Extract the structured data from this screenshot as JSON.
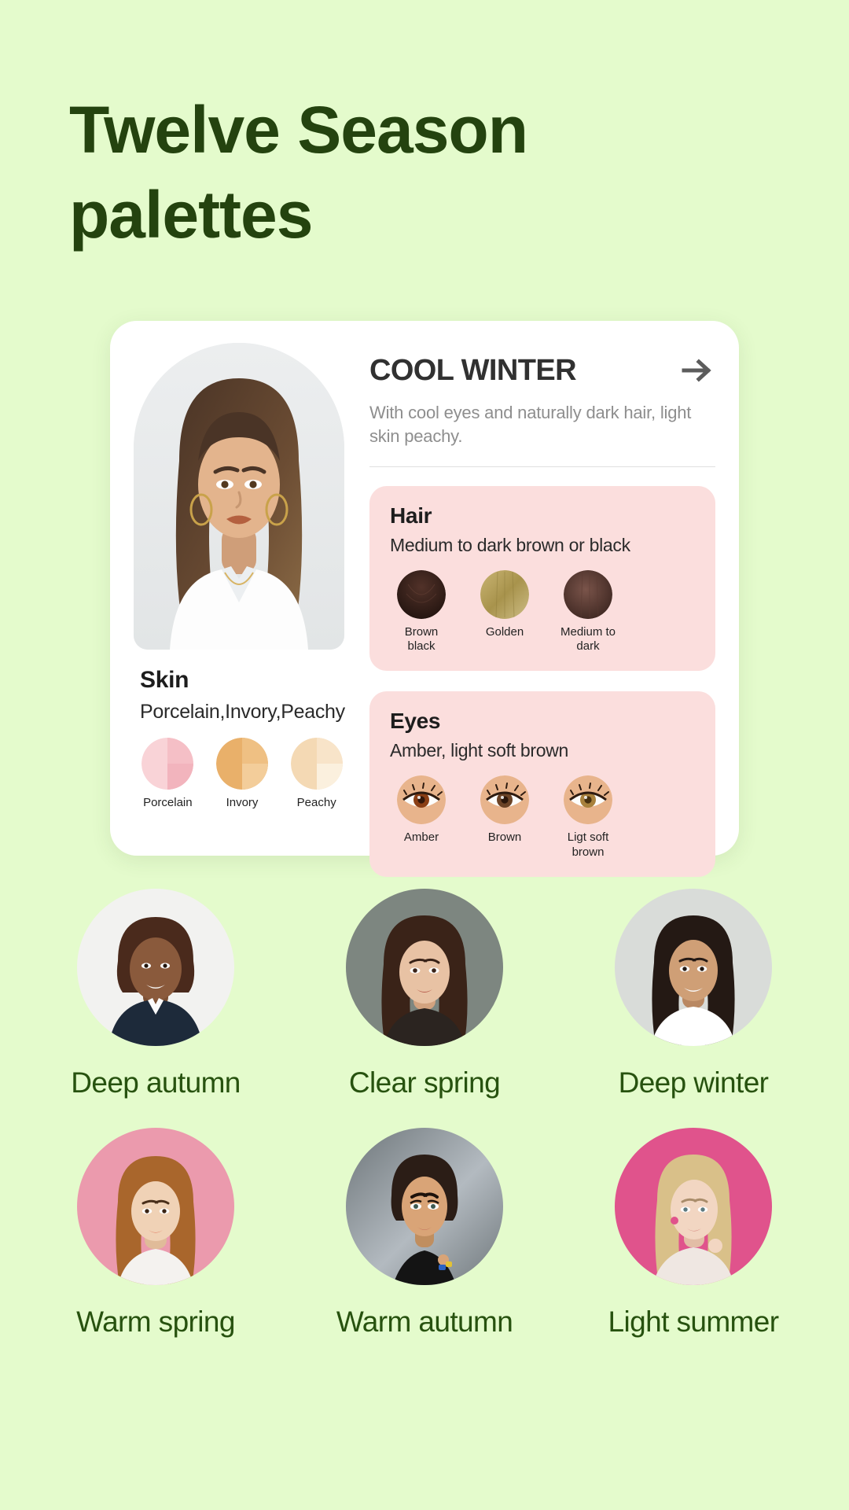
{
  "theme": {
    "background": "#e4fbcc",
    "title_color": "#24430f",
    "card_background": "#ffffff",
    "feature_box_background": "#fbdedd",
    "label_color": "#27520f"
  },
  "page": {
    "title": "Twelve Season palettes"
  },
  "card": {
    "season_name": "COOL WINTER",
    "arrow_icon": "arrow-right-icon",
    "description": "With cool eyes and naturally dark hair, light skin peachy.",
    "portrait_alt": "Cool winter model portrait",
    "skin": {
      "title": "Skin",
      "description": "Porcelain,Invory,Peachy",
      "swatches": [
        {
          "label": "Porcelain",
          "color": "#f7c9ce",
          "color2": "#fbdade"
        },
        {
          "label": "Invory",
          "color": "#e9b06a",
          "color2": "#f2cb93"
        },
        {
          "label": "Peachy",
          "color": "#f5dcb9",
          "color2": "#faeddb"
        }
      ]
    },
    "hair": {
      "title": "Hair",
      "description": "Medium to dark brown or black",
      "swatches": [
        {
          "label": "Brown black",
          "color": "#2b1a16",
          "color2": "#4a2f27"
        },
        {
          "label": "Golden",
          "color": "#b09a52",
          "color2": "#d9c98f"
        },
        {
          "label": "Medium to dark",
          "color": "#4b2f2a",
          "color2": "#6b4a42"
        }
      ]
    },
    "eyes": {
      "title": "Eyes",
      "description": "Amber, light soft brown",
      "swatches": [
        {
          "label": "Amber",
          "iris": "#8b3f15",
          "pupil": "#3a1a08"
        },
        {
          "label": "Brown",
          "iris": "#6b4326",
          "pupil": "#2e1a0c"
        },
        {
          "label": "Ligt soft brown",
          "iris": "#a8813c",
          "pupil": "#4a3112"
        }
      ]
    }
  },
  "seasons": [
    {
      "label": "Deep autumn",
      "bg": "#f2f2f0",
      "hair": "#4a2a1c",
      "skin": "#8a5a3c",
      "cloth": "#1d2a3a"
    },
    {
      "label": "Clear spring",
      "bg": "#7d8680",
      "hair": "#3a2318",
      "skin": "#e8c2a4",
      "cloth": "#2b2420"
    },
    {
      "label": "Deep winter",
      "bg": "#d9dcd9",
      "hair": "#241914",
      "skin": "#cf9f76",
      "cloth": "#ffffff"
    },
    {
      "label": "Warm spring",
      "bg": "#eb9aad",
      "hair": "#a9662c",
      "skin": "#f0d2b6",
      "cloth": "#f4f2ef"
    },
    {
      "label": "Warm autumn",
      "bg": "#8f969a",
      "hair": "#2b1d16",
      "skin": "#d9a477",
      "cloth": "#141414"
    },
    {
      "label": "Light summer",
      "bg": "#e0538c",
      "hair": "#d9c089",
      "skin": "#f2d6c2",
      "cloth": "#efe7e2"
    }
  ]
}
